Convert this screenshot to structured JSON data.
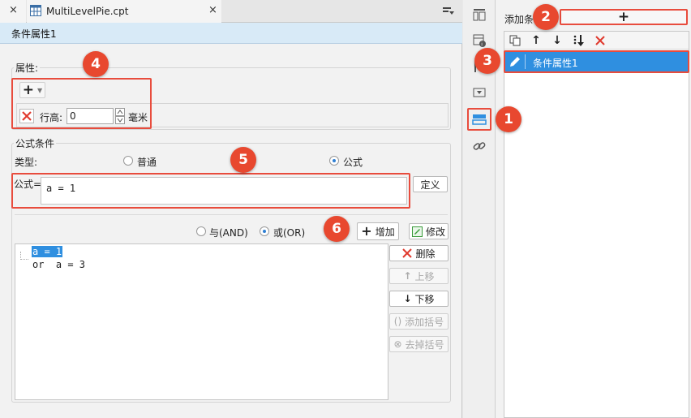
{
  "tabs": [
    {
      "label": "",
      "close": "×"
    },
    {
      "label": "MultiLevelPie.cpt",
      "close": "×"
    }
  ],
  "dialog": {
    "title": "条件属性1",
    "attributes": {
      "legend": "属性:",
      "add_symbol": "+",
      "row_height_label": "行高:",
      "row_height_value": "0",
      "unit": "毫米"
    },
    "formula_condition": {
      "legend": "公式条件",
      "type_label": "类型:",
      "type_options": [
        "普通",
        "公式"
      ],
      "selected_type": "公式",
      "formula_label": "公式=",
      "formula_value": "a = 1",
      "define_button": "定义",
      "logic_options": [
        "与(AND)",
        "或(OR)"
      ],
      "selected_logic": "或(OR)",
      "add_button": "增加",
      "modify_button": "修改",
      "conditions": [
        "a = 1",
        "or  a = 3"
      ],
      "side_buttons": {
        "delete": "删除",
        "move_up": "上移",
        "move_down": "下移",
        "add_bracket": "添加括号",
        "remove_bracket": "去掉括号"
      }
    }
  },
  "right_panel": {
    "add_label": "添加条",
    "add_symbol": "+",
    "items": [
      "条件属性1"
    ]
  },
  "badges": [
    "1",
    "2",
    "3",
    "4",
    "5",
    "6"
  ],
  "colors": {
    "accent_red": "#e84c3d",
    "badge_red": "#e8482f",
    "selection_blue": "#2f8fe0",
    "title_blue": "#d8eaf7"
  }
}
